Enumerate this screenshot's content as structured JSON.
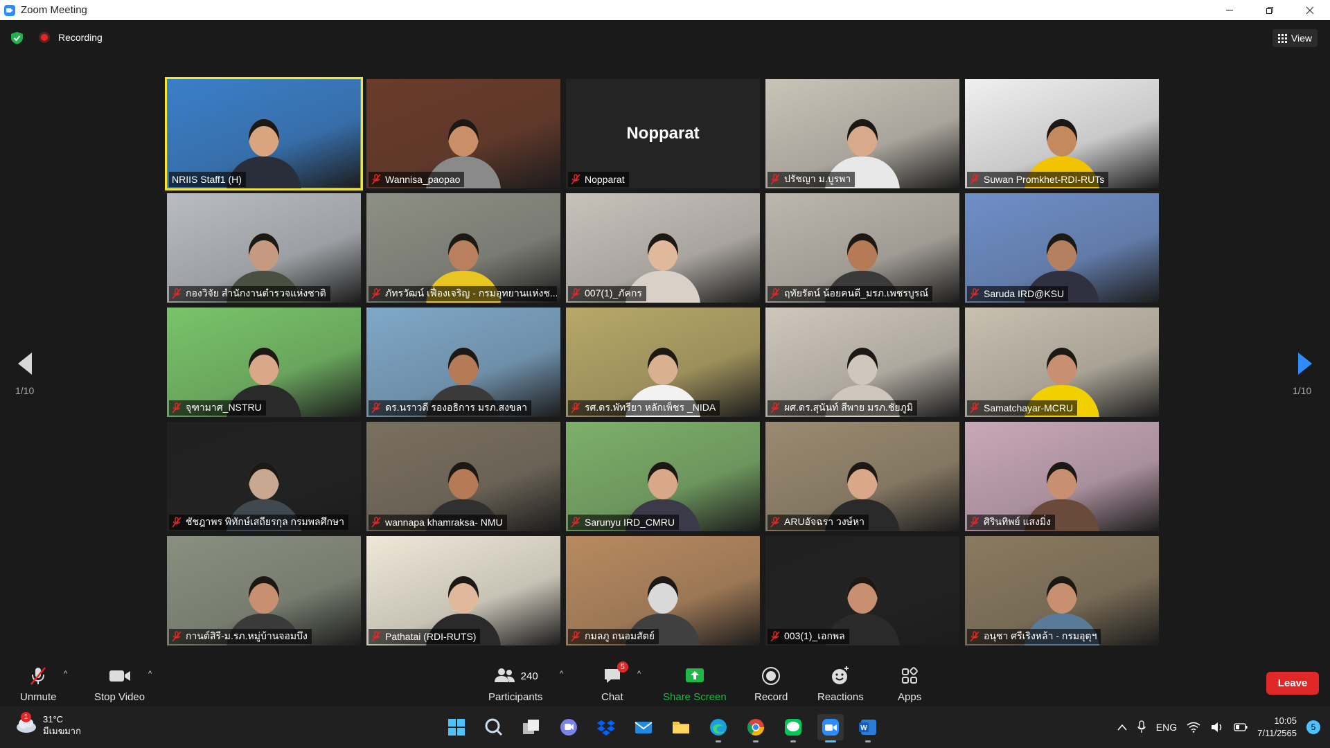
{
  "window": {
    "title": "Zoom Meeting"
  },
  "topbar": {
    "recording_label": "Recording",
    "view_label": "View"
  },
  "pagination": {
    "left_page": "1/10",
    "right_page": "1/10"
  },
  "tiles": [
    {
      "name": "NRIIS Staff1 (H)",
      "muted": false,
      "active": true,
      "video": true,
      "bg": "#3a7fc9",
      "skin": "#d9a57e",
      "shirt": "#2a2e3a"
    },
    {
      "name": "Wannisa_paopao",
      "muted": true,
      "video": true,
      "bg": "#6b3b2a",
      "skin": "#c99068",
      "shirt": "#8a8a8a"
    },
    {
      "name": "Nopparat",
      "muted": true,
      "video": false,
      "display": "Nopparat"
    },
    {
      "name": "ปรัชญา ม.บูรพา",
      "muted": true,
      "video": true,
      "bg": "#c9c3b8",
      "skin": "#d8a98a",
      "shirt": "#e8e8e8"
    },
    {
      "name": "Suwan Promkhet-RDI-RUTs",
      "muted": true,
      "video": true,
      "bg": "#f0f0f0",
      "skin": "#c48a5e",
      "shirt": "#f2c300"
    },
    {
      "name": "กองวิจัย สำนักงานตำรวจแห่งชาติ",
      "muted": true,
      "video": true,
      "bg": "#b9bcc2",
      "skin": "#c69a80",
      "shirt": "#4a5040"
    },
    {
      "name": "ภัทรวัฒน์ เฟื่องเจริญ - กรมอุทยานแห่งช...",
      "muted": true,
      "video": true,
      "bg": "#8d9085",
      "skin": "#b98060",
      "shirt": "#e8c520"
    },
    {
      "name": "007(1)_ภัคกร",
      "muted": true,
      "video": true,
      "bg": "#c8c2bb",
      "skin": "#e0b89c",
      "shirt": "#d9d0c8"
    },
    {
      "name": "ฤทัยรัตน์ น้อยคนดี_มรภ.เพชรบูรณ์",
      "muted": true,
      "video": true,
      "bg": "#bdb7ae",
      "skin": "#b57a56",
      "shirt": "#3a3a3a"
    },
    {
      "name": "Saruda IRD@KSU",
      "muted": true,
      "video": true,
      "bg": "#6f8fc8",
      "skin": "#b58060",
      "shirt": "#303040"
    },
    {
      "name": "จุฑามาศ_NSTRU",
      "muted": true,
      "video": true,
      "bg": "#79c46a",
      "skin": "#d8a888",
      "shirt": "#2a2a2a"
    },
    {
      "name": "ดร.นราวดี รองอธิการ มรภ.สงขลา",
      "muted": true,
      "video": true,
      "bg": "#7fa8c8",
      "skin": "#b57a56",
      "shirt": "#3a3a3a"
    },
    {
      "name": "รศ.ดร.พัทรียา หลักเพ็ชร _NIDA",
      "muted": true,
      "video": true,
      "bg": "#b8a868",
      "skin": "#d9b090",
      "shirt": "#f2f2f2"
    },
    {
      "name": "ผศ.ดร.สุนันท์ สีพาย มรภ.ชัยภูมิ",
      "muted": true,
      "video": true,
      "bg": "#cfc7bc",
      "skin": "#cfc7bc",
      "shirt": "#cfc7bc"
    },
    {
      "name": "Samatchayar-MCRU",
      "muted": true,
      "video": true,
      "bg": "#c8c0b0",
      "skin": "#c89070",
      "shirt": "#f2d000"
    },
    {
      "name": "ชัชฎาพร พิทักษ์เสถียรกุล กรมพลศึกษา",
      "muted": true,
      "video": true,
      "bg": "#202020",
      "skin": "#c8a890",
      "shirt": "#404850"
    },
    {
      "name": "wannapa khamraksa- NMU",
      "muted": true,
      "video": true,
      "bg": "#7a7060",
      "skin": "#b57a56",
      "shirt": "#303030"
    },
    {
      "name": "Sarunyu IRD_CMRU",
      "muted": true,
      "video": true,
      "bg": "#7db06a",
      "skin": "#d9a888",
      "shirt": "#3a3a48"
    },
    {
      "name": "ARUอัจฉรา วงษ์หา",
      "muted": true,
      "video": true,
      "bg": "#9a8a70",
      "skin": "#d9a888",
      "shirt": "#2a2a2a"
    },
    {
      "name": "ศิรินทิพย์ แสงมิ่ง",
      "muted": true,
      "video": true,
      "bg": "#c9a8b8",
      "skin": "#c89070",
      "shirt": "#6a4a3a"
    },
    {
      "name": "กานต์สิรี-ม.รภ.หมู่บ้านจอมบึง",
      "muted": true,
      "video": true,
      "bg": "#8a9080",
      "skin": "#c89070",
      "shirt": "#3a3a3a"
    },
    {
      "name": "Pathatai (RDI-RUTS)",
      "muted": true,
      "video": true,
      "bg": "#efe8d8",
      "skin": "#e0b89c",
      "shirt": "#2a2a2a"
    },
    {
      "name": "กมลภู ถนอมสัตย์",
      "muted": true,
      "video": true,
      "bg": "#b88a60",
      "skin": "#d9d9d9",
      "shirt": "#404040"
    },
    {
      "name": "003(1)_เอกพล",
      "muted": true,
      "video": true,
      "bg": "#202020",
      "skin": "#c89070",
      "shirt": "#2a2a2a"
    },
    {
      "name": "อนุชา ศรีเริงหล้า - กรมอุตุฯ",
      "muted": true,
      "video": true,
      "bg": "#8a7a60",
      "skin": "#c89070",
      "shirt": "#5a7a9a"
    }
  ],
  "toolbar": {
    "unmute": "Unmute",
    "stop_video": "Stop Video",
    "participants": "Participants",
    "participants_count": "240",
    "chat": "Chat",
    "chat_badge": "5",
    "share_screen": "Share Screen",
    "record": "Record",
    "reactions": "Reactions",
    "apps": "Apps",
    "leave": "Leave"
  },
  "taskbar": {
    "weather_temp": "31°C",
    "weather_desc": "มีเมฆมาก",
    "weather_badge": "1",
    "lang": "ENG",
    "time": "10:05",
    "date": "7/11/2565",
    "notifications": "5"
  },
  "colors": {
    "accent": "#2d8cff",
    "active_speaker": "#f5e62e",
    "leave": "#e02828",
    "share": "#1fb848",
    "muted_mic": "#e02828"
  }
}
